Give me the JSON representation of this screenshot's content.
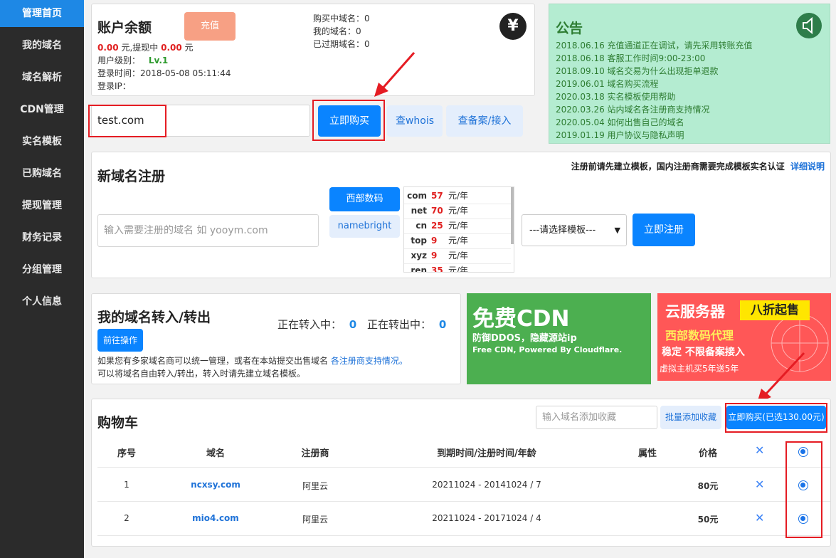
{
  "sidebar": {
    "items": [
      {
        "label": "管理首页",
        "active": true
      },
      {
        "label": "我的域名"
      },
      {
        "label": "域名解析"
      },
      {
        "label": "CDN管理"
      },
      {
        "label": "实名模板"
      },
      {
        "label": "已购域名"
      },
      {
        "label": "提现管理"
      },
      {
        "label": "财务记录"
      },
      {
        "label": "分组管理"
      },
      {
        "label": "个人信息"
      }
    ]
  },
  "account": {
    "title": "账户余额",
    "recharge_label": "充值",
    "balance": "0.00",
    "balance_unit": "元,提现中",
    "withdrawing": "0.00",
    "withdraw_unit": "元",
    "level_label": "用户级别：",
    "level": "Lv.1",
    "login_time": "登录时间：2018-05-08 05:11:44",
    "login_ip": "登录IP：",
    "stat_buying": "购买中域名：0",
    "stat_mine": "我的域名：0",
    "stat_expired": "已过期域名：0",
    "yen_icon": "¥"
  },
  "search": {
    "value": "test.com",
    "buy_label": "立即购买",
    "whois_label": "查whois",
    "beian_label": "查备案/接入"
  },
  "notice": {
    "title": "公告",
    "items": [
      "2018.06.16 充值通道正在调试，请先采用转账充值",
      "2018.06.18 客服工作时间9:00-23:00",
      "2018.09.10 域名交易为什么出现拒单退款",
      "2019.06.01 域名购买流程",
      "2020.03.18 实名模板使用帮助",
      "2020.03.26 站内域名各注册商支持情况",
      "2020.05.04 如何出售自己的域名",
      "2019.01.19 用户协议与隐私声明"
    ]
  },
  "register": {
    "title": "新域名注册",
    "hint": "注册前请先建立模板，国内注册商需要完成模板实名认证",
    "hint_link": "详细说明",
    "input_placeholder": "输入需要注册的域名 如 yooym.com",
    "registrar_a": "西部数码",
    "registrar_b": "namebright",
    "tlds": [
      {
        "tld": "com",
        "price": "57",
        "unit": "元/年"
      },
      {
        "tld": "net",
        "price": "70",
        "unit": "元/年"
      },
      {
        "tld": "cn",
        "price": "25",
        "unit": "元/年"
      },
      {
        "tld": "top",
        "price": "9",
        "unit": "元/年"
      },
      {
        "tld": "xyz",
        "price": "9",
        "unit": "元/年"
      },
      {
        "tld": "ren",
        "price": "35",
        "unit": "元/年"
      }
    ],
    "template_select": "---请选择模板---",
    "submit_label": "立即注册"
  },
  "transfer": {
    "title": "我的域名转入/转出",
    "in_label": "正在转入中：",
    "in_count": "0",
    "out_label": "正在转出中：",
    "out_count": "0",
    "go_label": "前往操作",
    "desc1": "如果您有多家域名商可以统一管理，或者在本站提交出售域名",
    "desc1_link": "各注册商支持情况。",
    "desc2": "可以将域名自由转入/转出，转入时请先建立域名模板。"
  },
  "banner_cdn": {
    "title": "免费CDN",
    "line1": "防御DDOS，隐藏源站ip",
    "line2": "Free CDN, Powered By Cloudflare."
  },
  "banner_cloud": {
    "title": "云服务器",
    "tag": "八折起售",
    "line1": "西部数码代理",
    "line2": "稳定 不限备案接入",
    "line3": "虚拟主机买5年送5年"
  },
  "cart": {
    "title": "购物车",
    "input_placeholder": "输入域名添加收藏",
    "batch_label": "批量添加收藏",
    "buy_label": "立即购买(已选130.00元)",
    "headers": [
      "序号",
      "域名",
      "注册商",
      "到期时间/注册时间/年龄",
      "属性",
      "价格"
    ],
    "rows": [
      {
        "no": "1",
        "domain": "ncxsy.com",
        "registrar": "阿里云",
        "dates": "20211024 - 20141024 / 7",
        "attr": "",
        "price": "80元"
      },
      {
        "no": "2",
        "domain": "mio4.com",
        "registrar": "阿里云",
        "dates": "20211024 - 20171024 / 4",
        "attr": "",
        "price": "50元"
      }
    ],
    "remove_icon": "✕"
  },
  "colors": {
    "accent": "#0a84ff",
    "sidebar": "#2b2b2b",
    "notice_bg": "#b4ecd1",
    "cdn_bg": "#4caf50",
    "cloud_bg": "#ff5757",
    "highlight": "#e51c23"
  }
}
